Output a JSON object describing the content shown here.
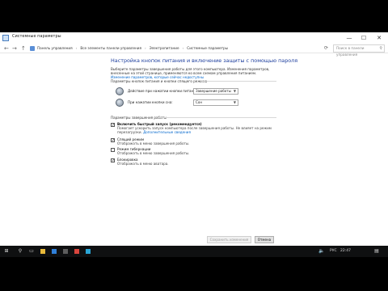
{
  "window": {
    "title": "Системные параметры",
    "minimize": "—",
    "maximize": "☐",
    "close": "✕"
  },
  "nav": {
    "back": "←",
    "forward": "→",
    "up": "↑",
    "refresh": "⟳",
    "breadcrumbs": [
      "Панель управления",
      "Все элементы панели управления",
      "Электропитание",
      "Системные параметры"
    ],
    "search_placeholder": "Поиск в панели управления"
  },
  "main": {
    "heading": "Настройка кнопок питания и включение защиты с помощью пароля",
    "intro": "Выберите параметры завершения работы для этого компьютера. Изменения параметров, внесенные на этой странице, применяются ко всем схемам управления питанием.",
    "intro_link": "Изменение параметров, которые сейчас недоступны",
    "power_section": {
      "header": "Параметры кнопок питания и кнопки спящего режима",
      "rows": [
        {
          "label": "Действие при нажатии кнопки питания:",
          "value": "Завершение работы"
        },
        {
          "label": "При нажатии кнопки сна:",
          "value": "Сон"
        }
      ]
    },
    "shutdown_section": {
      "header": "Параметры завершения работы",
      "options": [
        {
          "label": "Включить быстрый запуск (рекомендуется)",
          "checked": true,
          "desc": "Помогает ускорить запуск компьютера после завершения работы. Не влияет на режим перезагрузки.",
          "link": "Дополнительные сведения"
        },
        {
          "label": "Спящий режим",
          "checked": true,
          "desc": "Отображать в меню завершения работы."
        },
        {
          "label": "Режим гибернации",
          "checked": false,
          "desc": "Отображать в меню завершения работы."
        },
        {
          "label": "Блокировка",
          "checked": true,
          "desc": "Отображать в меню аватара."
        }
      ]
    },
    "save_button": "Сохранить изменения",
    "cancel_button": "Отмена"
  },
  "taskbar": {
    "language": "РУС",
    "time": "22:47",
    "apps": [
      {
        "icon": "folder-icon",
        "color": "#e8b93a"
      },
      {
        "icon": "browser-icon",
        "color": "#2f7fd8"
      },
      {
        "icon": "store-icon",
        "color": "#5c5c5c"
      },
      {
        "icon": "chrome-icon",
        "color": "#d9453d"
      },
      {
        "icon": "app-icon",
        "color": "#2aa6d6"
      }
    ]
  }
}
